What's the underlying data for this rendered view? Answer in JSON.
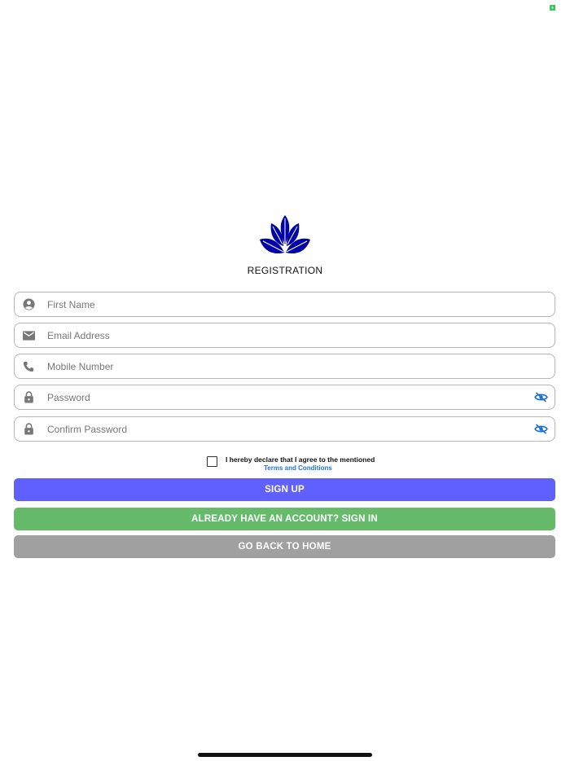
{
  "status_bar": {
    "battery_color": "#34c759"
  },
  "header": {
    "title": "REGISTRATION",
    "logo_color": "#0000a8"
  },
  "form": {
    "first_name_placeholder": "First Name",
    "email_placeholder": "Email Address",
    "mobile_placeholder": "Mobile Number",
    "password_placeholder": "Password",
    "confirm_password_placeholder": "Confirm Password"
  },
  "terms": {
    "declaration": "I hereby declare that I agree to the mentioned",
    "link_label": "Terms and Conditions",
    "checked": false
  },
  "buttons": {
    "sign_up": "SIGN UP",
    "sign_in": "ALREADY HAVE AN ACCOUNT? SIGN IN",
    "home": "GO BACK TO HOME"
  },
  "colors": {
    "sign_up": "#6060ff",
    "sign_in": "#66bb6a",
    "home": "#a0a0a0",
    "eye_icon": "#1a6fd1",
    "field_icon": "#777777"
  },
  "icons": {
    "first_name": "person-circle-icon",
    "email": "envelope-icon",
    "mobile": "phone-icon",
    "password": "lock-icon",
    "confirm_password": "lock-icon",
    "visibility": "eye-off-icon"
  }
}
